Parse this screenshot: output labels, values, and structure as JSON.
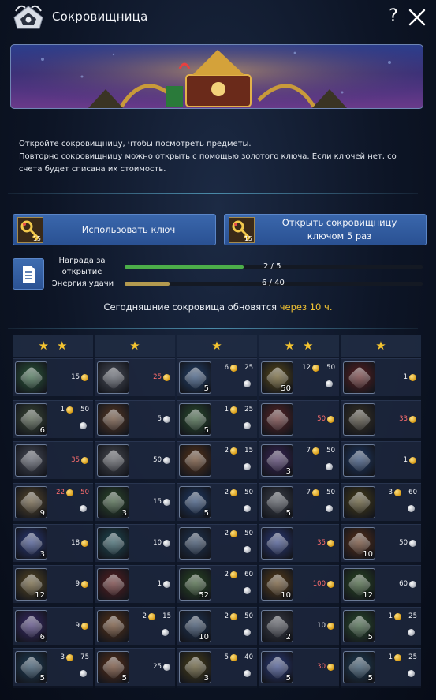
{
  "window": {
    "title": "Сокровищница",
    "help_label": "?"
  },
  "description": {
    "line1": "Откройте сокровищницу, чтобы посмотреть предметы.",
    "line2": "Повторно сокровищницу можно открыть с помощью золотого ключа. Если ключей нет, со счета будет списана их стоимость."
  },
  "buttons": {
    "use_key": {
      "label": "Использовать ключ",
      "key_count": "15"
    },
    "open_5": {
      "label": "Открыть сокровищницу ключом 5 раз",
      "key_count": "15"
    }
  },
  "progress": {
    "reward": {
      "label": "Награда за открытие",
      "value": "2 / 5",
      "current": 2,
      "max": 5,
      "color": "#4cae49"
    },
    "luck": {
      "label": "Энергия удачи",
      "value": "6 / 40",
      "current": 6,
      "max": 40,
      "color": "#b39a4f"
    }
  },
  "refresh": {
    "prefix": "Сегодняшние сокровища обновятся ",
    "highlight": "через 10 ч."
  },
  "colors": {
    "accent_button": "#2f5a9c",
    "price_red": "#ff6e6e",
    "star": "#f4c430"
  },
  "columns": [
    {
      "stars": 2,
      "items": [
        {
          "icon": "green-crystal-sword-icon",
          "color": "#2c5a3a",
          "qty": "",
          "price1": "15",
          "coin1": "gold",
          "price2": "",
          "coin2": "",
          "red": false
        },
        {
          "icon": "rune-stone-icon",
          "color": "#3c4a36",
          "qty": "6",
          "price1": "1",
          "coin1": "gold",
          "price2": "50",
          "coin2": "silver",
          "red": false
        },
        {
          "icon": "silver-armor-icon",
          "color": "#4a4e5a",
          "qty": "",
          "price1": "35",
          "coin1": "gold",
          "price2": "",
          "coin2": "",
          "red": true
        },
        {
          "icon": "helmet-icon",
          "color": "#5a4a2c",
          "qty": "9",
          "price1": "22",
          "coin1": "gold",
          "price2": "50",
          "coin2": "silver",
          "red": true
        },
        {
          "icon": "blue-gold-chest-icon",
          "color": "#2a3a7a",
          "qty": "3",
          "price1": "18",
          "coin1": "gold",
          "price2": "",
          "coin2": "",
          "red": false
        },
        {
          "icon": "gold-ring-icon",
          "color": "#5a4a22",
          "qty": "12",
          "price1": "9",
          "coin1": "gold",
          "price2": "",
          "coin2": "",
          "red": false
        },
        {
          "icon": "red-blue-box-icon",
          "color": "#3a2a6a",
          "qty": "6",
          "price1": "9",
          "coin1": "gold",
          "price2": "",
          "coin2": "",
          "red": false
        },
        {
          "icon": "teal-chest-icon",
          "color": "#1e3e56",
          "qty": "5",
          "price1": "3",
          "coin1": "gold",
          "price2": "75",
          "coin2": "silver",
          "red": false
        }
      ]
    },
    {
      "stars": 1,
      "items": [
        {
          "icon": "silver-dragon-icon",
          "color": "#4a4e58",
          "qty": "",
          "price1": "25",
          "coin1": "gold",
          "price2": "",
          "coin2": "",
          "red": true
        },
        {
          "icon": "red-potion-icon",
          "color": "#5a3a24",
          "qty": "",
          "price1": "5",
          "coin1": "silver",
          "price2": "",
          "coin2": "",
          "red": false
        },
        {
          "icon": "silver-coin-icon",
          "color": "#4a4c52",
          "qty": "",
          "price1": "50",
          "coin1": "silver",
          "price2": "",
          "coin2": "",
          "red": false
        },
        {
          "icon": "green-scroll-icon",
          "color": "#2c4a2a",
          "qty": "3",
          "price1": "15",
          "coin1": "silver",
          "price2": "",
          "coin2": "",
          "red": false
        },
        {
          "icon": "cyan-gem-icon",
          "color": "#1e4a52",
          "qty": "",
          "price1": "10",
          "coin1": "silver",
          "price2": "",
          "coin2": "",
          "red": false
        },
        {
          "icon": "red-feather-icon",
          "color": "#5a1e1e",
          "qty": "",
          "price1": "1",
          "coin1": "silver",
          "price2": "",
          "coin2": "",
          "red": false
        },
        {
          "icon": "orange-leaf-icon",
          "color": "#5a3418",
          "qty": "",
          "price1": "2",
          "coin1": "gold",
          "price2": "15",
          "coin2": "silver",
          "red": false
        },
        {
          "icon": "orange-orb-icon",
          "color": "#5a3018",
          "qty": "5",
          "price1": "25",
          "coin1": "silver",
          "price2": "",
          "coin2": "",
          "red": false
        }
      ]
    },
    {
      "stars": 1,
      "items": [
        {
          "icon": "blue-card-icon",
          "color": "#22406a",
          "qty": "5",
          "price1": "6",
          "coin1": "gold",
          "price2": "25",
          "coin2": "silver",
          "red": false
        },
        {
          "icon": "green-card-icon",
          "color": "#2a4e2c",
          "qty": "5",
          "price1": "1",
          "coin1": "gold",
          "price2": "25",
          "coin2": "silver",
          "red": false
        },
        {
          "icon": "orange-leaf-icon",
          "color": "#5a3418",
          "qty": "",
          "price1": "2",
          "coin1": "gold",
          "price2": "15",
          "coin2": "silver",
          "red": false
        },
        {
          "icon": "blue-scroll-icon",
          "color": "#1e3a66",
          "qty": "5",
          "price1": "2",
          "coin1": "gold",
          "price2": "50",
          "coin2": "silver",
          "red": false
        },
        {
          "icon": "blue-chest-icon",
          "color": "#1e3452",
          "qty": "",
          "price1": "2",
          "coin1": "gold",
          "price2": "50",
          "coin2": "silver",
          "red": false
        },
        {
          "icon": "green-ticket-icon",
          "color": "#2a4a22",
          "qty": "52",
          "price1": "2",
          "coin1": "gold",
          "price2": "60",
          "coin2": "silver",
          "red": false
        },
        {
          "icon": "blue-chest-icon",
          "color": "#1e3452",
          "qty": "10",
          "price1": "2",
          "coin1": "gold",
          "price2": "50",
          "coin2": "silver",
          "red": false
        },
        {
          "icon": "gold-leaf-icon",
          "color": "#4a4018",
          "qty": "3",
          "price1": "5",
          "coin1": "gold",
          "price2": "40",
          "coin2": "silver",
          "red": false
        }
      ]
    },
    {
      "stars": 2,
      "items": [
        {
          "icon": "gold-crystal-icon",
          "color": "#5a4a18",
          "qty": "50",
          "price1": "12",
          "coin1": "gold",
          "price2": "50",
          "coin2": "silver",
          "red": false
        },
        {
          "icon": "red-gift-box-icon",
          "color": "#5a2424",
          "qty": "",
          "price1": "50",
          "coin1": "gold",
          "price2": "",
          "coin2": "",
          "red": true
        },
        {
          "icon": "purple-orb-icon",
          "color": "#3a2456",
          "qty": "3",
          "price1": "7",
          "coin1": "gold",
          "price2": "50",
          "coin2": "silver",
          "red": false
        },
        {
          "icon": "silver-compass-icon",
          "color": "#3e424a",
          "qty": "5",
          "price1": "7",
          "coin1": "gold",
          "price2": "50",
          "coin2": "silver",
          "red": false
        },
        {
          "icon": "blue-gold-chest-icon",
          "color": "#2a3a7a",
          "qty": "",
          "price1": "35",
          "coin1": "gold",
          "price2": "",
          "coin2": "",
          "red": true
        },
        {
          "icon": "gold-sun-icon",
          "color": "#5a3e18",
          "qty": "10",
          "price1": "100",
          "coin1": "gold",
          "price2": "",
          "coin2": "",
          "red": true
        },
        {
          "icon": "silver-chest-icon",
          "color": "#3a3c44",
          "qty": "2",
          "price1": "10",
          "coin1": "gold",
          "price2": "",
          "coin2": "",
          "red": false
        },
        {
          "icon": "blue-gold-chest-icon",
          "color": "#2a3a7a",
          "qty": "5",
          "price1": "30",
          "coin1": "gold",
          "price2": "",
          "coin2": "",
          "red": true
        }
      ]
    },
    {
      "stars": 1,
      "items": [
        {
          "icon": "red-feather-icon",
          "color": "#5a1e1e",
          "qty": "",
          "price1": "1",
          "coin1": "gold",
          "price2": "",
          "coin2": "",
          "red": false
        },
        {
          "icon": "treasure-chest-icon",
          "color": "#3a3424",
          "qty": "",
          "price1": "33",
          "coin1": "gold",
          "price2": "",
          "coin2": "",
          "red": true
        },
        {
          "icon": "blue-scroll-icon",
          "color": "#1e3a66",
          "qty": "",
          "price1": "1",
          "coin1": "gold",
          "price2": "",
          "coin2": "",
          "red": false
        },
        {
          "icon": "gold-leaf-icon",
          "color": "#4a4018",
          "qty": "",
          "price1": "3",
          "coin1": "gold",
          "price2": "60",
          "coin2": "silver",
          "red": false
        },
        {
          "icon": "orange-orb-icon",
          "color": "#5a3018",
          "qty": "10",
          "price1": "50",
          "coin1": "silver",
          "price2": "",
          "coin2": "",
          "red": false
        },
        {
          "icon": "green-ticket-icon",
          "color": "#2a4a22",
          "qty": "12",
          "price1": "60",
          "coin1": "silver",
          "price2": "",
          "coin2": "",
          "red": false
        },
        {
          "icon": "green-card-icon",
          "color": "#2a4e2c",
          "qty": "5",
          "price1": "1",
          "coin1": "gold",
          "price2": "25",
          "coin2": "silver",
          "red": false
        },
        {
          "icon": "teal-chest-icon",
          "color": "#1e3e56",
          "qty": "5",
          "price1": "1",
          "coin1": "gold",
          "price2": "25",
          "coin2": "silver",
          "red": false
        }
      ]
    }
  ]
}
